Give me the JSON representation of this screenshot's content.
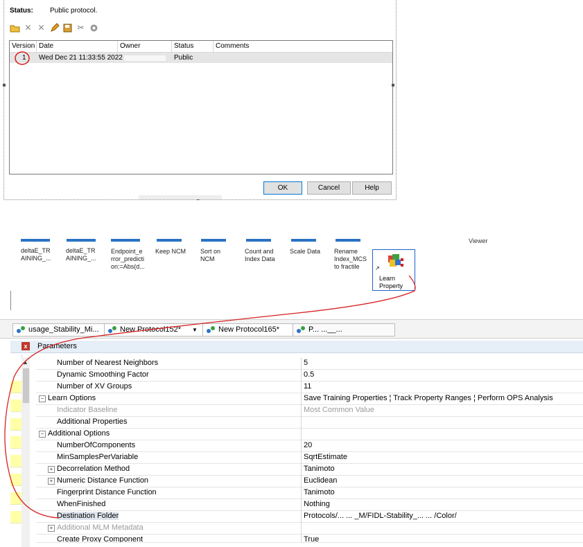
{
  "dialog": {
    "status_label": "Status:",
    "status_value": "Public protocol.",
    "toolbar": [
      "open-folder-icon",
      "delete-icon",
      "delete-all-icon",
      "edit-pencil-icon",
      "save-icon",
      "cut-icon",
      "tag-icon"
    ],
    "table": {
      "columns": [
        "Version",
        "Date",
        "Owner",
        "Status",
        "Comments"
      ],
      "rows": [
        {
          "version": "1",
          "date": "Wed Dec 21 11:33:55 2022",
          "owner": "",
          "status": "Public",
          "comments": ""
        }
      ]
    },
    "buttons": {
      "ok": "OK",
      "cancel": "Cancel",
      "help": "Help"
    }
  },
  "canvas": {
    "nodes": [
      {
        "label": "deltaE_TR\nAINING_..."
      },
      {
        "label": "deltaE_TR\nAINING_..."
      },
      {
        "label": "Endpoint_e\nrror_predicti\non:=Abs(d..."
      },
      {
        "label": "Keep NCM"
      },
      {
        "label": "Sort on\nNCM"
      },
      {
        "label": "Count and\nIndex Data"
      },
      {
        "label": "Scale Data"
      },
      {
        "label": "Rename\nIndex_MCS\nto fractile"
      }
    ],
    "learn_property": "Learn\nProperty",
    "viewer": "Viewer"
  },
  "tabs": [
    {
      "label": "usage_Stability_Mi..."
    },
    {
      "label": "New Protocol152*"
    },
    {
      "label": "New Protocol165*"
    },
    {
      "label": "P...  ...__..."
    }
  ],
  "parameters": {
    "title": "Parameters",
    "rows": [
      {
        "name": "Number of Nearest Neighbors",
        "value": "5"
      },
      {
        "name": "Dynamic Smoothing Factor",
        "value": "0.5"
      },
      {
        "name": "Number of XV Groups",
        "value": "11"
      },
      {
        "name": "Learn Options",
        "value": "Save Training Properties ¦ Track Property Ranges ¦ Perform OPS Analysis"
      },
      {
        "name": "Indicator Baseline",
        "value": "Most Common Value"
      },
      {
        "name": "Additional Properties",
        "value": ""
      },
      {
        "name": "Additional Options",
        "value": ""
      },
      {
        "name": "NumberOfComponents",
        "value": "20"
      },
      {
        "name": "MinSamplesPerVariable",
        "value": "SqrtEstimate"
      },
      {
        "name": "Decorrelation Method",
        "value": "Tanimoto"
      },
      {
        "name": "Numeric Distance Function",
        "value": "Euclidean"
      },
      {
        "name": "Fingerprint Distance Function",
        "value": "Tanimoto"
      },
      {
        "name": "WhenFinished",
        "value": "Nothing"
      },
      {
        "name": "Destination Folder",
        "value": "Protocols/...  ...  _M/FIDL-Stability_...  ...  /Color/"
      },
      {
        "name": "Additional MLM Metadata",
        "value": ""
      },
      {
        "name": "Create Proxy Component",
        "value": "True"
      }
    ]
  },
  "colors": {
    "annotation": "#d62020",
    "selection": "#1e5fc9",
    "highlight_yellow": "#ffffa8"
  }
}
